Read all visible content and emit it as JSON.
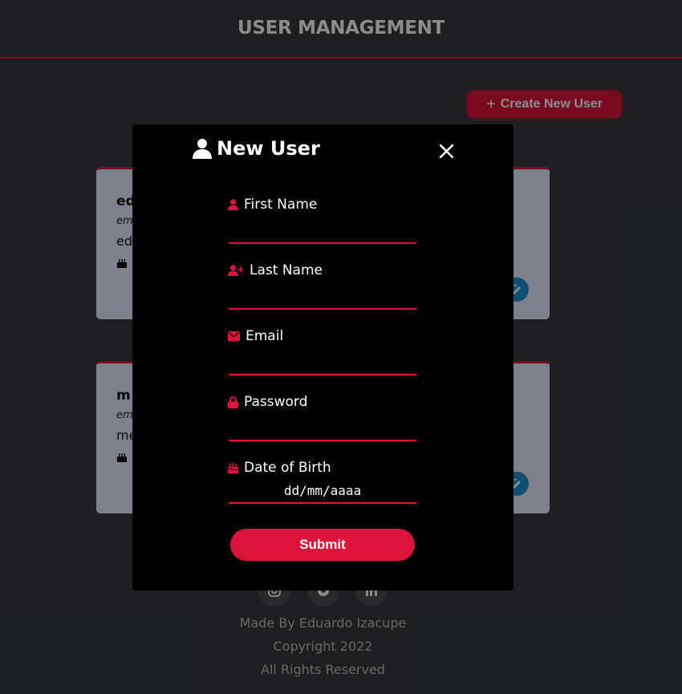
{
  "header": {
    "title": "USER MANAGEMENT"
  },
  "toolbar": {
    "create_label": "Create New User",
    "create_icon": "plus-icon"
  },
  "cards": [
    {
      "name": "ed",
      "label": "em",
      "value": "ed"
    },
    {
      "name": "m",
      "label": "em",
      "value": "me"
    }
  ],
  "footer": {
    "social": [
      "instagram-icon",
      "github-icon",
      "linkedin-icon"
    ],
    "made_by": "Made By Eduardo Izacupe",
    "copyright": "Copyright 2022",
    "rights": "All Rights Reserved"
  },
  "modal": {
    "title": "New User",
    "fields": {
      "first_name": {
        "label": "First Name",
        "value": ""
      },
      "last_name": {
        "label": "Last Name",
        "value": ""
      },
      "email": {
        "label": "Email",
        "value": ""
      },
      "password": {
        "label": "Password",
        "value": ""
      },
      "dob": {
        "label": "Date of Birth",
        "value": "dd/mm/aaaa"
      }
    },
    "submit_label": "Submit"
  },
  "colors": {
    "accent": "#dc143c",
    "background": "#37383b",
    "card": "#e6e9ff",
    "edit": "#1e8fd1"
  }
}
